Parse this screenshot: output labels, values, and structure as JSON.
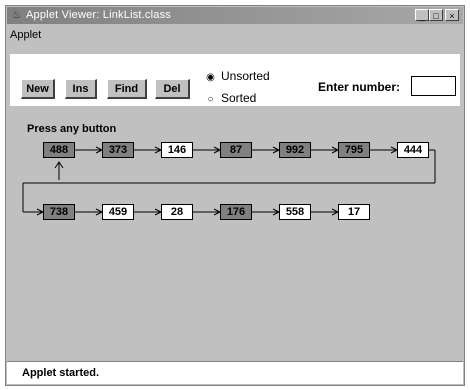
{
  "window": {
    "title": "Applet Viewer: LinkList.class",
    "controls": {
      "minimize": "_",
      "maximize": "□",
      "close": "×"
    }
  },
  "menu": {
    "applet": "Applet"
  },
  "toolbar": {
    "new_label": "New",
    "ins_label": "Ins",
    "find_label": "Find",
    "del_label": "Del",
    "radio_unsorted": "Unsorted",
    "radio_sorted": "Sorted",
    "selected_order": "Unsorted",
    "enter_label": "Enter number:",
    "enter_value": ""
  },
  "canvas": {
    "message": "Press any button",
    "nodes": [
      {
        "value": "488",
        "highlighted": true
      },
      {
        "value": "373",
        "highlighted": true
      },
      {
        "value": "146",
        "highlighted": false
      },
      {
        "value": "87",
        "highlighted": true
      },
      {
        "value": "992",
        "highlighted": true
      },
      {
        "value": "795",
        "highlighted": true
      },
      {
        "value": "444",
        "highlighted": false
      },
      {
        "value": "738",
        "highlighted": true
      },
      {
        "value": "459",
        "highlighted": false
      },
      {
        "value": "28",
        "highlighted": false
      },
      {
        "value": "176",
        "highlighted": true
      },
      {
        "value": "558",
        "highlighted": false
      },
      {
        "value": "17",
        "highlighted": false
      }
    ],
    "current_node": 0
  },
  "status": {
    "text": "Applet started."
  },
  "colors": {
    "window_bg": "#c0c0c0",
    "highlight_node": "#808080",
    "plain_node": "#ffffff"
  }
}
